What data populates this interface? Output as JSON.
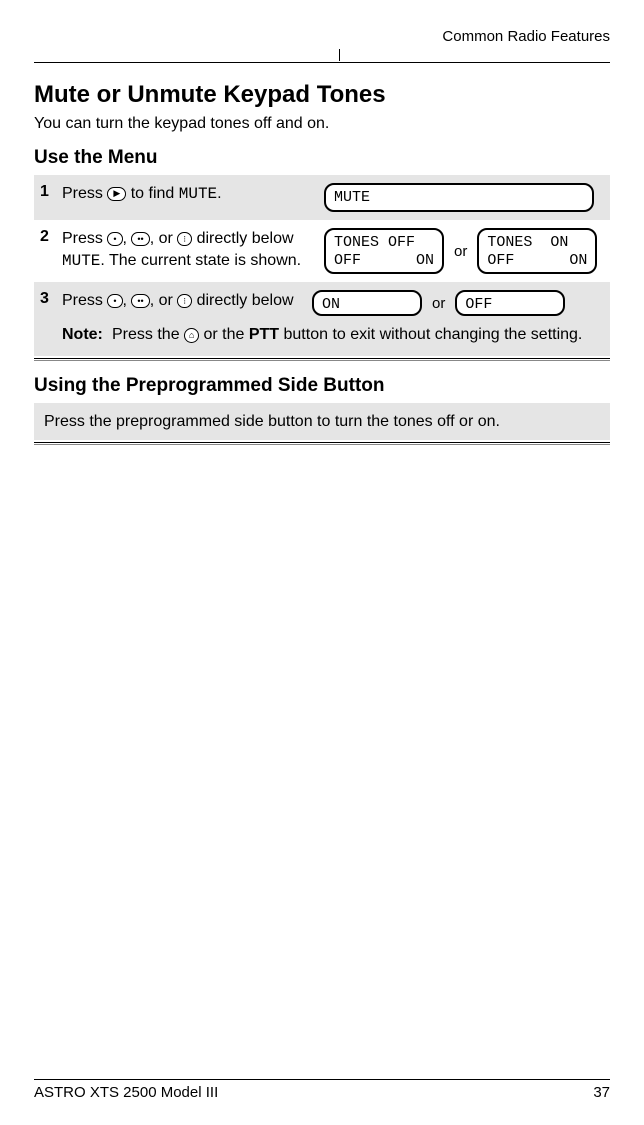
{
  "header": {
    "running": "Common Radio Features"
  },
  "title": "Mute or Unmute Keypad Tones",
  "intro": "You can turn the keypad tones off and on.",
  "section1": {
    "heading": "Use the Menu"
  },
  "steps": {
    "s1": {
      "num": "1",
      "pre": "Press ",
      "glyph": "▶",
      "mid": " to find ",
      "code": "MUTE",
      "post": ".",
      "display": "MUTE"
    },
    "s2": {
      "num": "2",
      "pre": "Press ",
      "g1": "•",
      "sep1": ", ",
      "g2": "••",
      "sep2": ", or ",
      "g3": "⁝",
      "mid": " directly below ",
      "code": "MUTE",
      "post": ". The current state is shown.",
      "lcdA_top": "TONES OFF",
      "lcdA_b1": "OFF",
      "lcdA_b2": "ON",
      "or": "or",
      "lcdB_top": "TONES  ON",
      "lcdB_b1": "OFF",
      "lcdB_b2": "ON"
    },
    "s3": {
      "num": "3",
      "pre": "Press ",
      "g1": "•",
      "sep1": ", ",
      "g2": "••",
      "sep2": ", or ",
      "g3": "⁝",
      "post": " directly below",
      "lcdA": "ON",
      "or": "or",
      "lcdB": "OFF"
    },
    "note": {
      "label": "Note:",
      "pre": "Press the ",
      "glyph": "⌂",
      "mid": " or the ",
      "bold": "PTT",
      "post": " button to exit without changing the setting."
    }
  },
  "section2": {
    "heading": "Using the Preprogrammed Side Button",
    "body": "Press the preprogrammed side button to turn the tones off or on."
  },
  "footer": {
    "model": "ASTRO XTS 2500 Model III",
    "page": "37"
  }
}
